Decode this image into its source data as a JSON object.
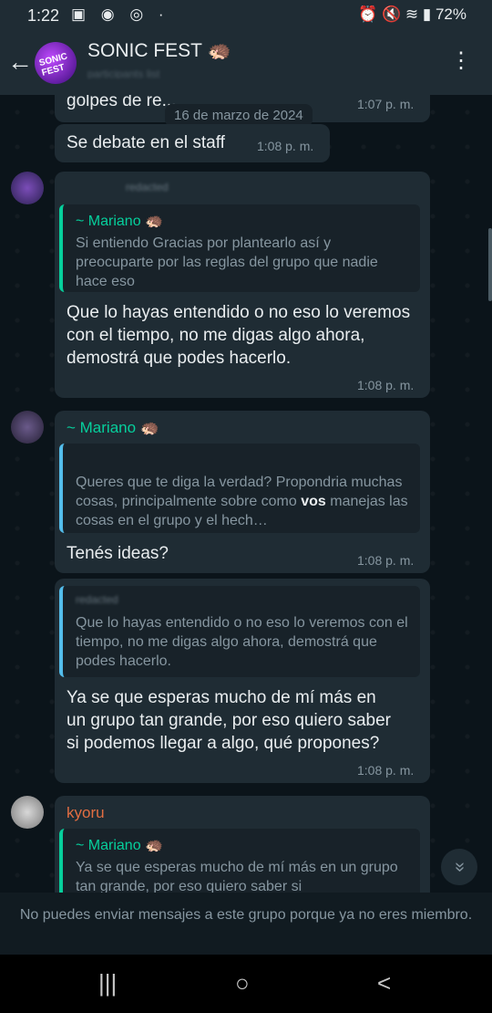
{
  "status": {
    "time": "1:22",
    "left_icons": "▣ ◉ ◎ ·",
    "right_icons": "⏰ 🔇 ≋ ▮",
    "battery": "72%"
  },
  "header": {
    "back_icon": "arrow-left",
    "avatar_text": "SONIC FEST",
    "title": "SONIC FEST 🦔",
    "subtitle": "participants list",
    "menu_icon": "more-vert"
  },
  "chat": {
    "partial_top": "golpes de re...",
    "partial_top_time": "1:07 p. m.",
    "date_pill": "16 de marzo de 2024",
    "m1": {
      "text": "Se debate en el staff",
      "time": "1:08 p. m."
    },
    "m2": {
      "sender": "redacted",
      "quote_name": "~ Mariano 🦔",
      "quote_text": "Si entiendo Gracias por plantearlo así y preocuparte por las reglas del grupo que nadie hace eso",
      "text": "Que lo hayas entendido o no eso lo veremos con el tiempo, no me digas algo ahora, demostrá que podes hacerlo.",
      "time": "1:08 p. m."
    },
    "m3": {
      "sender": "~ Mariano 🦔",
      "quote_text_a": "Queres que te diga la verdad? Propondria muchas cosas, principalmente sobre como ",
      "quote_bold": "vos",
      "quote_text_b": " manejas las cosas en el grupo y el hech…",
      "text": "Tenés ideas?",
      "time": "1:08 p. m."
    },
    "m4": {
      "quote_name": "redacted",
      "quote_text": "Que lo hayas entendido o no eso lo veremos con el tiempo, no me digas algo ahora, demostrá que podes hacerlo.",
      "text": "Ya se que esperas mucho de mí más en un grupo tan grande, por eso quiero saber si podemos llegar a algo, qué propones?",
      "time": "1:08 p. m."
    },
    "m5": {
      "sender": "kyoru",
      "quote_name": "~ Mariano 🦔",
      "quote_text": "Ya se que esperas mucho de mí más en un grupo tan grande, por eso quiero saber si"
    }
  },
  "scroll_fab": "«",
  "notice": "No puedes enviar mensajes a este grupo porque ya no eres miembro.",
  "nav": {
    "recents": "|||",
    "home": "○",
    "back": "<"
  }
}
